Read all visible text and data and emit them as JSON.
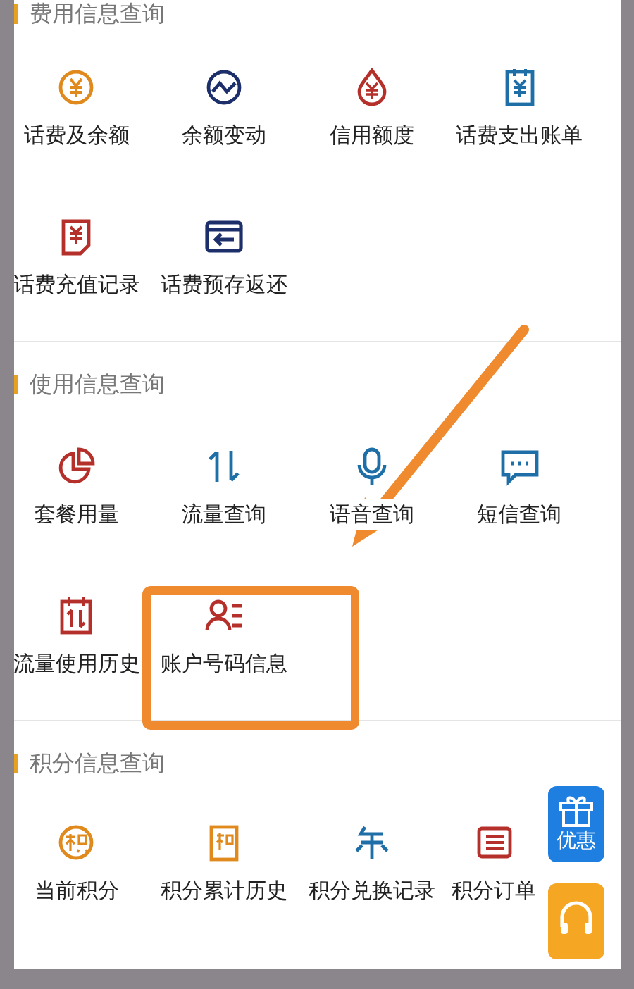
{
  "sections": [
    {
      "title": "费用信息查询",
      "items": [
        {
          "label": "话费及余额"
        },
        {
          "label": "余额变动"
        },
        {
          "label": "信用额度"
        },
        {
          "label": "话费支出账单"
        },
        {
          "label": "话费充值记录"
        },
        {
          "label": "话费预存返还"
        }
      ]
    },
    {
      "title": "使用信息查询",
      "items": [
        {
          "label": "套餐用量"
        },
        {
          "label": "流量查询"
        },
        {
          "label": "语音查询"
        },
        {
          "label": "短信查询"
        },
        {
          "label": "流量使用历史"
        },
        {
          "label": "账户号码信息"
        }
      ]
    },
    {
      "title": "积分信息查询",
      "items": [
        {
          "label": "当前积分"
        },
        {
          "label": "积分累计历史"
        },
        {
          "label": "积分兑换记录"
        },
        {
          "label": "积分订单"
        }
      ]
    }
  ],
  "float_buttons": [
    {
      "kind": "gift",
      "label": "优惠"
    },
    {
      "kind": "headset"
    }
  ]
}
